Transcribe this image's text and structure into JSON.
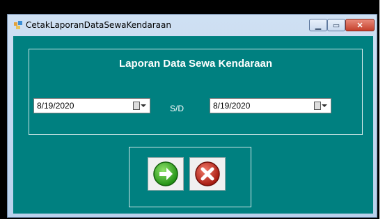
{
  "window": {
    "title": "CetakLaporanDataSewaKendaraan"
  },
  "form": {
    "heading": "Laporan Data Sewa Kendaraan",
    "date_from": "8/19/2020",
    "separator": "S/D",
    "date_to": "8/19/2020"
  },
  "colors": {
    "client_background": "#008080",
    "go_button": "#2fae1d",
    "cancel_button": "#c6261b"
  },
  "icons": {
    "app": "app-icon",
    "minimize": "minimize-icon",
    "maximize": "maximize-icon",
    "close": "close-icon",
    "calendar": "calendar-dropdown-icon",
    "go": "green-arrow-right-icon",
    "cancel": "red-x-icon"
  }
}
